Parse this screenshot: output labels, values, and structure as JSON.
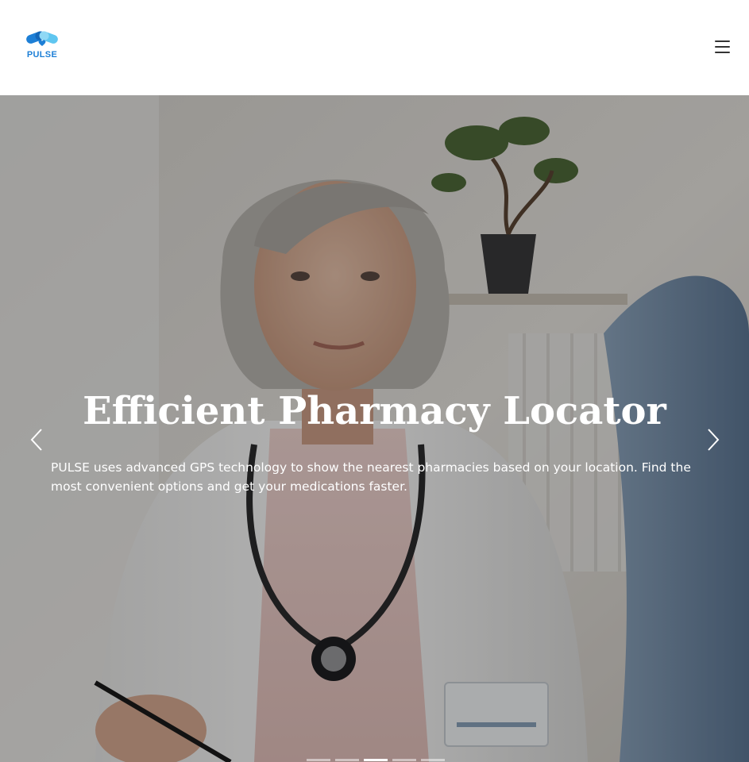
{
  "brand": {
    "name": "PULSE",
    "logo_icon": "capsule-heart-logo",
    "accent_color": "#1d7fd6",
    "light_accent": "#5fc6f0"
  },
  "header": {
    "menu_icon": "hamburger-menu-icon"
  },
  "carousel": {
    "active_slide": 3,
    "slide_count": 5,
    "title": "Efficient Pharmacy Locator",
    "description": "PULSE uses advanced GPS technology to show the nearest pharmacies based on your location. Find the most convenient options and get your medications faster.",
    "prev_icon": "chevron-left-icon",
    "next_icon": "chevron-right-icon",
    "background_image": "doctor-consultation-photo"
  }
}
